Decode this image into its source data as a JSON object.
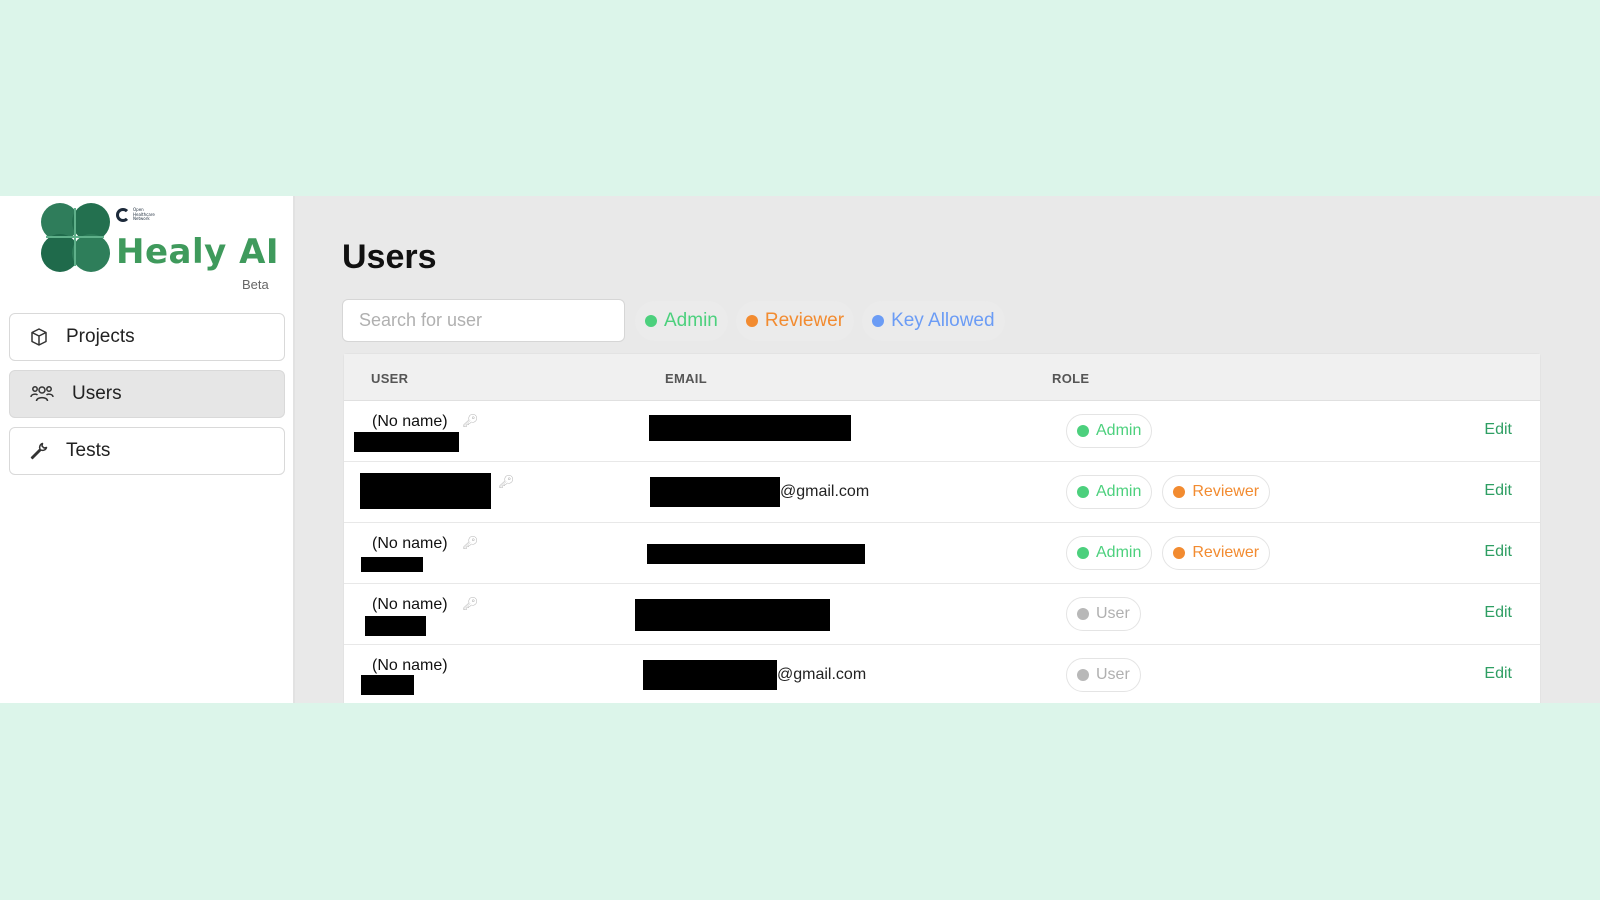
{
  "brand": {
    "name": "Healy AI",
    "tag": "Beta",
    "org_text": "Open Healthcare Network"
  },
  "sidebar": {
    "items": [
      {
        "label": "Projects",
        "icon": "box-icon",
        "active": false
      },
      {
        "label": "Users",
        "icon": "users-icon",
        "active": true
      },
      {
        "label": "Tests",
        "icon": "wrench-icon",
        "active": false
      }
    ]
  },
  "main": {
    "title": "Users",
    "search_placeholder": "Search for user",
    "filters": [
      {
        "label": "Admin",
        "color": "#4cd07d"
      },
      {
        "label": "Reviewer",
        "color": "#f28b30"
      },
      {
        "label": "Key Allowed",
        "color": "#6b9cf5"
      }
    ]
  },
  "table": {
    "headers": {
      "user": "USER",
      "email": "EMAIL",
      "role": "ROLE"
    },
    "edit_label": "Edit",
    "rows": [
      {
        "name": "(No name)",
        "email_suffix": "",
        "roles": [
          "Admin"
        ]
      },
      {
        "name": "",
        "email_suffix": "@gmail.com",
        "roles": [
          "Admin",
          "Reviewer"
        ]
      },
      {
        "name": "(No name)",
        "email_suffix": "",
        "roles": [
          "Admin",
          "Reviewer"
        ]
      },
      {
        "name": "(No name)",
        "email_suffix": "",
        "roles": [
          "User"
        ]
      },
      {
        "name": "(No name)",
        "email_suffix": "@gmail.com",
        "roles": [
          "User"
        ]
      }
    ]
  },
  "colors": {
    "admin": "#4cd07d",
    "reviewer": "#f28b30",
    "key": "#6b9cf5",
    "user": "#b8b8b8",
    "accent": "#2e9e63",
    "brand": "#3f9a5c"
  }
}
